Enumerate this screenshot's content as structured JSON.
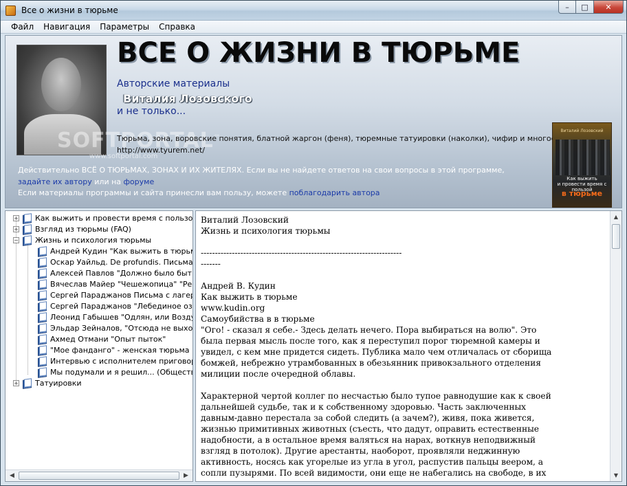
{
  "window": {
    "title": "Все о жизни в тюрьме",
    "min_label": "–",
    "max_label": "□",
    "close_label": "✕"
  },
  "menu": [
    "Файл",
    "Навигация",
    "Параметры",
    "Справка"
  ],
  "banner": {
    "title": "ВСЕ О ЖИЗНИ В ТЮРЬМЕ",
    "authors_line": "Авторские материалы",
    "author_name": "Виталия Лозовского",
    "not_only": "и не только...",
    "topics": "Тюрьма, зона, воровские понятия, блатной жаргон (феня), тюремные татуировки (наколки), чифир и многое другое...",
    "site_url": "http://www.tyurem.net/",
    "line1": "Действительно ВСЁ О ТЮРЬМАХ, ЗОНАХ И ИХ ЖИТЕЛЯХ. Если вы не найдете ответов на свои вопросы в этой программе,",
    "ask_author": "задайте их автору",
    "or_on": "или на",
    "forum": "форуме",
    "line3_prefix": "Если материалы программы и сайта принесли вам пользу, можете",
    "thank_author": "поблагодарить автора",
    "watermark": "SOFTPORTAL",
    "watermark_tm": "™",
    "watermark_url": "www.softportal.com",
    "book": {
      "author": "Виталий Лозовский",
      "subtitle_1": "Как выжить",
      "subtitle_2": "и провести время с пользой",
      "main": "в тюрьме"
    }
  },
  "tree": {
    "items": [
      {
        "label": "Как выжить и провести время  с пользой в т",
        "level": 0,
        "expander": "+"
      },
      {
        "label": "Взгляд из тюрьмы (FAQ)",
        "level": 0,
        "expander": "+"
      },
      {
        "label": "Жизнь и психология тюрьмы",
        "level": 0,
        "expander": "−"
      },
      {
        "label": "Андрей Кудин  \"Как выжить в тюрьме\" -",
        "level": 1
      },
      {
        "label": "Оскар Уайльд. De profundis. Письма с тк",
        "level": 1
      },
      {
        "label": "Алексей Павлов \"Должно было быть не",
        "level": 1
      },
      {
        "label": "Вячеслав Майер \"Чешежопица\" \"Ресниц",
        "level": 1
      },
      {
        "label": "Сергей Параджанов Письма с лагеря",
        "level": 1
      },
      {
        "label": "Сергей Параджанов \"Лебединое озеро.",
        "level": 1
      },
      {
        "label": "Леонид Габышев \"Одлян, или Воздух св",
        "level": 1
      },
      {
        "label": "Эльдар Зейналов, \"Отсюда не выходят",
        "level": 1
      },
      {
        "label": "Ахмед Отмани \"Опыт пыток\"",
        "level": 1
      },
      {
        "label": "\"Мое фанданго\" - женская тюрьма",
        "level": 1
      },
      {
        "label": "Интервью с исполнителем приговоров Б",
        "level": 1
      },
      {
        "label": "Мы подумали и я решил... (Общественн",
        "level": 1
      },
      {
        "label": "Татуировки",
        "level": 0,
        "expander": "+"
      }
    ]
  },
  "text": {
    "lines": [
      "Виталий Лозовский",
      "Жизнь и психология тюрьмы",
      "",
      "-----------------------------------------------------------------------",
      "-------",
      "",
      "Андрей В. Кудин",
      "Как выжить в тюрьме",
      "www.kudin.org",
      "Самоубийства в в тюрьме",
      "\"Ого! - сказал я себе.- Здесь делать нечего. Пора выбираться на волю\". Это",
      "была первая мысль после того, как я переступил порог тюремной камеры и",
      "увидел, с кем мне придется сидеть. Публика мало чем отличалась от сборища",
      "бомжей, небрежно утрамбованных в обезьянник привокзального отделения",
      "милиции после очередной облавы.",
      "",
      "Характерной чертой коллег по несчастью было тупое равнодушие как к своей",
      "дальнейшей судьбе, так и к собственному здоровью. Часть заключенных",
      "давным-давно перестала за собой следить (а зачем?), живя, пока живется,",
      "жизнью примитивных животных (съесть, что дадут, оправить естественные",
      "надобности, а в остальное время валяться на нарах, воткнув неподвижный",
      "взгляд в потолок). Другие арестанты, наоборот, проявляли неджинную",
      "активность, носясь как угорелые из угла в угол, распустив пальцы веером, а",
      "сопли пузырями. По всей видимости, они еще не набегались на свободе, в их"
    ]
  }
}
